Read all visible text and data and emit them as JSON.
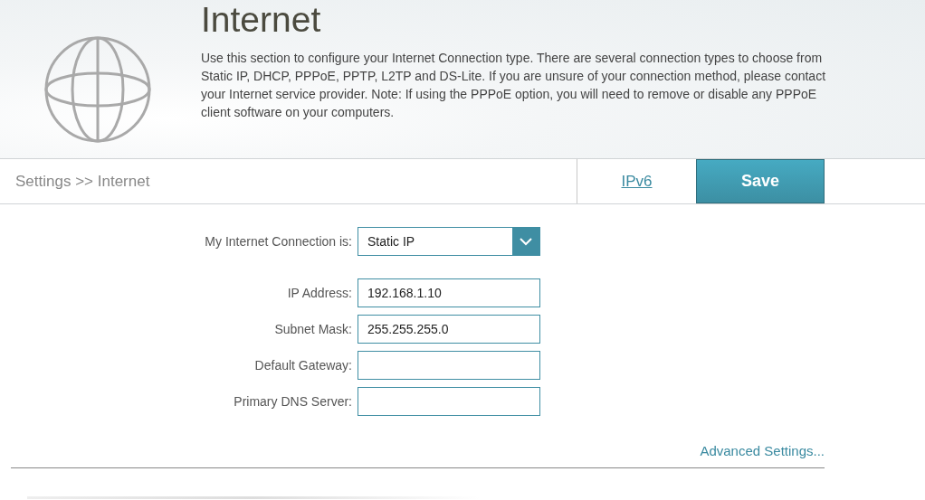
{
  "header": {
    "title": "Internet",
    "description": "Use this section to configure your Internet Connection type. There are several connection types to choose from Static IP, DHCP, PPPoE, PPTP, L2TP and DS-Lite. If you are unsure of your connection method, please contact your Internet service provider. Note: If using the PPPoE option, you will need to remove or disable any PPPoE client software on your computers."
  },
  "breadcrumb": "Settings >> Internet",
  "ipv6_link": "IPv6",
  "save_button": "Save",
  "fields": [
    {
      "kind": "select",
      "label": "My Internet Connection is:",
      "value": "Static IP"
    },
    {
      "kind": "text",
      "label": "IP Address:",
      "value": "192.168.1.10"
    },
    {
      "kind": "text",
      "label": "Subnet Mask:",
      "value": "255.255.255.0"
    },
    {
      "kind": "text",
      "label": "Default Gateway:"
    },
    {
      "kind": "text",
      "label": "Primary DNS Server:"
    }
  ],
  "advanced_link": "Advanced Settings..."
}
